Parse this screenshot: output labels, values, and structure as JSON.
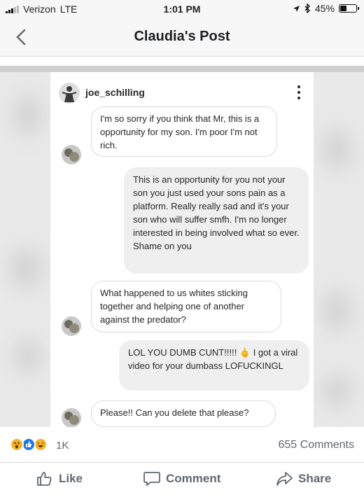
{
  "status_bar": {
    "carrier": "Verizon",
    "network": "LTE",
    "time": "1:01 PM",
    "battery_percent": "45%",
    "battery_level": 0.45
  },
  "nav": {
    "title": "Claudia's Post"
  },
  "screenshot": {
    "username": "joe_schilling",
    "messages": [
      {
        "from": "them",
        "text": "I'm so sorry if you think that Mr, this is a opportunity for my son. I'm poor I'm not rich."
      },
      {
        "from": "me",
        "text": "This is an opportunity for you not your son you just used your sons pain as a platform. Really really sad and it's your son who will suffer smfh.  I'm no longer interested in being involved what so ever. Shame on you"
      },
      {
        "from": "them",
        "text": "What happened to us whites sticking together and helping one of another against the predator?"
      },
      {
        "from": "me",
        "text": "LOL YOU DUMB CUNT!!!!! 🖕 I got a viral video for your dumbass LOFUCKINGL"
      },
      {
        "from": "them",
        "text": "Please!! Can you delete that please?"
      }
    ]
  },
  "reactions": {
    "count": "1K",
    "icons": [
      "wow-icon",
      "like-icon",
      "haha-icon"
    ],
    "colors": {
      "wow": "#f7b125",
      "like": "#1877f2",
      "haha": "#f7b125"
    },
    "comments": "655 Comments"
  },
  "actions": {
    "like": "Like",
    "comment": "Comment",
    "share": "Share"
  }
}
